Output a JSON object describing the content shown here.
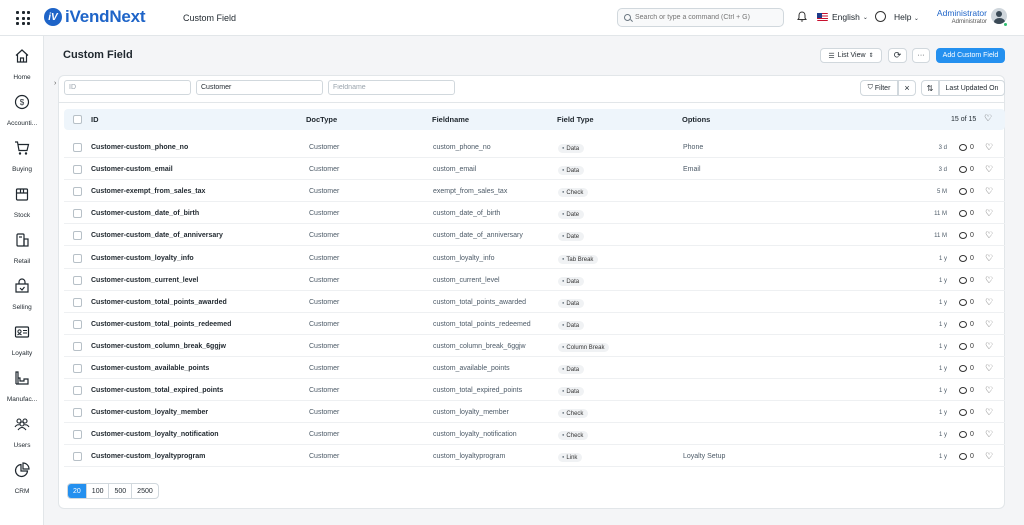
{
  "app": {
    "brand": "iVendNext",
    "logo_mark": "iV"
  },
  "header": {
    "breadcrumb": "Custom Field",
    "search_placeholder": "Search or type a command (Ctrl + G)",
    "language": "English",
    "help": "Help",
    "user_name": "Administrator",
    "user_role": "Administrator"
  },
  "sidebar": [
    {
      "label": "Home",
      "icon": "home-icon"
    },
    {
      "label": "Accounti...",
      "icon": "dollar-icon"
    },
    {
      "label": "Buying",
      "icon": "cart-icon"
    },
    {
      "label": "Stock",
      "icon": "box-icon"
    },
    {
      "label": "Retail",
      "icon": "pos-icon"
    },
    {
      "label": "Selling",
      "icon": "selling-icon"
    },
    {
      "label": "Loyalty",
      "icon": "card-icon"
    },
    {
      "label": "Manufac...",
      "icon": "factory-icon"
    },
    {
      "label": "Users",
      "icon": "users-icon"
    },
    {
      "label": "CRM",
      "icon": "pie-icon"
    }
  ],
  "page": {
    "title": "Custom Field",
    "list_view": "List View",
    "more": "···",
    "add_button": "Add Custom Field"
  },
  "filters": {
    "id_placeholder": "ID",
    "doctype_value": "Customer",
    "fieldname_placeholder": "Fieldname",
    "filter_label": "Filter",
    "clear": "×",
    "sort_label": "Last Updated On"
  },
  "table": {
    "columns": [
      "ID",
      "DocType",
      "Fieldname",
      "Field Type",
      "Options"
    ],
    "count": "15 of 15",
    "rows": [
      {
        "id": "Customer-custom_phone_no",
        "doctype": "Customer",
        "fieldname": "custom_phone_no",
        "type": "Data",
        "options": "Phone",
        "age": "3 d",
        "comments": "0"
      },
      {
        "id": "Customer-custom_email",
        "doctype": "Customer",
        "fieldname": "custom_email",
        "type": "Data",
        "options": "Email",
        "age": "3 d",
        "comments": "0"
      },
      {
        "id": "Customer-exempt_from_sales_tax",
        "doctype": "Customer",
        "fieldname": "exempt_from_sales_tax",
        "type": "Check",
        "options": "",
        "age": "5 M",
        "comments": "0"
      },
      {
        "id": "Customer-custom_date_of_birth",
        "doctype": "Customer",
        "fieldname": "custom_date_of_birth",
        "type": "Date",
        "options": "",
        "age": "11 M",
        "comments": "0"
      },
      {
        "id": "Customer-custom_date_of_anniversary",
        "doctype": "Customer",
        "fieldname": "custom_date_of_anniversary",
        "type": "Date",
        "options": "",
        "age": "11 M",
        "comments": "0"
      },
      {
        "id": "Customer-custom_loyalty_info",
        "doctype": "Customer",
        "fieldname": "custom_loyalty_info",
        "type": "Tab Break",
        "options": "",
        "age": "1 y",
        "comments": "0"
      },
      {
        "id": "Customer-custom_current_level",
        "doctype": "Customer",
        "fieldname": "custom_current_level",
        "type": "Data",
        "options": "",
        "age": "1 y",
        "comments": "0"
      },
      {
        "id": "Customer-custom_total_points_awarded",
        "doctype": "Customer",
        "fieldname": "custom_total_points_awarded",
        "type": "Data",
        "options": "",
        "age": "1 y",
        "comments": "0"
      },
      {
        "id": "Customer-custom_total_points_redeemed",
        "doctype": "Customer",
        "fieldname": "custom_total_points_redeemed",
        "type": "Data",
        "options": "",
        "age": "1 y",
        "comments": "0"
      },
      {
        "id": "Customer-custom_column_break_6ggjw",
        "doctype": "Customer",
        "fieldname": "custom_column_break_6ggjw",
        "type": "Column Break",
        "options": "",
        "age": "1 y",
        "comments": "0"
      },
      {
        "id": "Customer-custom_available_points",
        "doctype": "Customer",
        "fieldname": "custom_available_points",
        "type": "Data",
        "options": "",
        "age": "1 y",
        "comments": "0"
      },
      {
        "id": "Customer-custom_total_expired_points",
        "doctype": "Customer",
        "fieldname": "custom_total_expired_points",
        "type": "Data",
        "options": "",
        "age": "1 y",
        "comments": "0"
      },
      {
        "id": "Customer-custom_loyalty_member",
        "doctype": "Customer",
        "fieldname": "custom_loyalty_member",
        "type": "Check",
        "options": "",
        "age": "1 y",
        "comments": "0"
      },
      {
        "id": "Customer-custom_loyalty_notification",
        "doctype": "Customer",
        "fieldname": "custom_loyalty_notification",
        "type": "Check",
        "options": "",
        "age": "1 y",
        "comments": "0"
      },
      {
        "id": "Customer-custom_loyaltyprogram",
        "doctype": "Customer",
        "fieldname": "custom_loyaltyprogram",
        "type": "Link",
        "options": "Loyalty Setup",
        "age": "1 y",
        "comments": "0"
      }
    ]
  },
  "pager": [
    "20",
    "100",
    "500",
    "2500"
  ],
  "colors": {
    "brand": "#1e64c8",
    "primary": "#2490ef",
    "header_bg": "#eef5fb"
  }
}
